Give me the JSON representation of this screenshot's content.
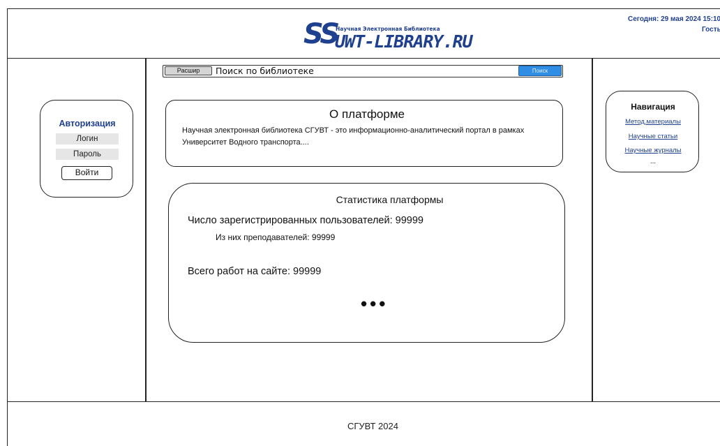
{
  "header": {
    "logo_mark": "SS",
    "logo_tagline": "Научная Электронная Библиотека",
    "logo_site": "UWT-LIBRARY.RU",
    "date_text": "Сегодня: 29 мая 2024 15:10",
    "user_text": "Гость"
  },
  "search": {
    "expand_label": "Расшир",
    "placeholder": "Поиск по библиотеке",
    "submit_label": "Поиск"
  },
  "auth": {
    "title": "Авторизация",
    "login_placeholder": "Логин",
    "password_placeholder": "Пароль",
    "submit_label": "Войти"
  },
  "about": {
    "title": "О платформе",
    "text": "Научная электронная библиотека СГУВТ - это информационно-аналитический портал в рамках Университет Водного транспорта...."
  },
  "stats": {
    "title": "Статистика платформы",
    "users_line": "Число зарегистрированных пользователей: 99999",
    "teachers_line": "Из них преподавателей: 99999",
    "works_line": "Всего работ на сайте: 99999",
    "more": "•••"
  },
  "nav": {
    "title": "Навигация",
    "links": [
      "Метод.материалы",
      "Научные статьи",
      "Научные журналы"
    ],
    "more": "..."
  },
  "footer": {
    "text": "СГУВТ 2024"
  },
  "colors": {
    "brand": "#1f3f8f",
    "search_button": "#2f8de4",
    "field_bg": "#e6e6e6"
  }
}
